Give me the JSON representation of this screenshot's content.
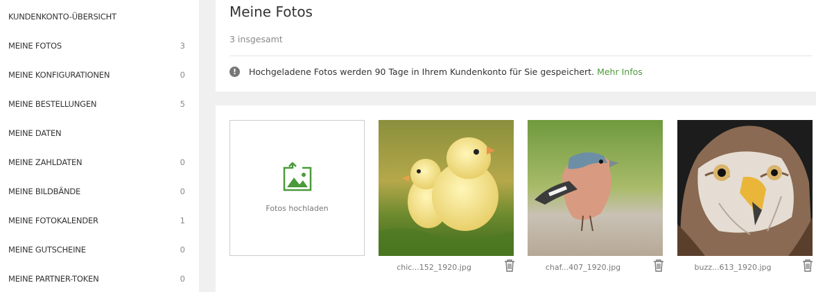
{
  "sidebar": {
    "items": [
      {
        "label": "KUNDENKONTO-ÜBERSICHT",
        "count": ""
      },
      {
        "label": "MEINE FOTOS",
        "count": "3"
      },
      {
        "label": "MEINE KONFIGURATIONEN",
        "count": "0"
      },
      {
        "label": "MEINE BESTELLUNGEN",
        "count": "5"
      },
      {
        "label": "MEINE DATEN",
        "count": ""
      },
      {
        "label": "MEINE ZAHLDATEN",
        "count": "0"
      },
      {
        "label": "MEINE BILDBÄNDE",
        "count": "0"
      },
      {
        "label": "MEINE FOTOKALENDER",
        "count": "1"
      },
      {
        "label": "MEINE GUTSCHEINE",
        "count": "0"
      },
      {
        "label": "MEINE PARTNER-TOKEN",
        "count": "0"
      }
    ]
  },
  "header": {
    "title": "Meine Fotos",
    "count_text": "3 insgesamt",
    "info_text": "Hochgeladene Fotos werden 90 Tage in Ihrem Kundenkonto für Sie gespeichert.",
    "info_link": "Mehr Infos"
  },
  "gallery": {
    "upload_label": "Fotos hochladen",
    "photos": [
      {
        "name": "chic...152_1920.jpg",
        "icon": "chick-photo"
      },
      {
        "name": "chaf...407_1920.jpg",
        "icon": "chaffinch-photo"
      },
      {
        "name": "buzz...613_1920.jpg",
        "icon": "buzzard-photo"
      }
    ]
  },
  "colors": {
    "accent_green": "#4a9a3a",
    "sidebar_bg": "#ffffff",
    "page_bg": "#f0f0f0"
  }
}
